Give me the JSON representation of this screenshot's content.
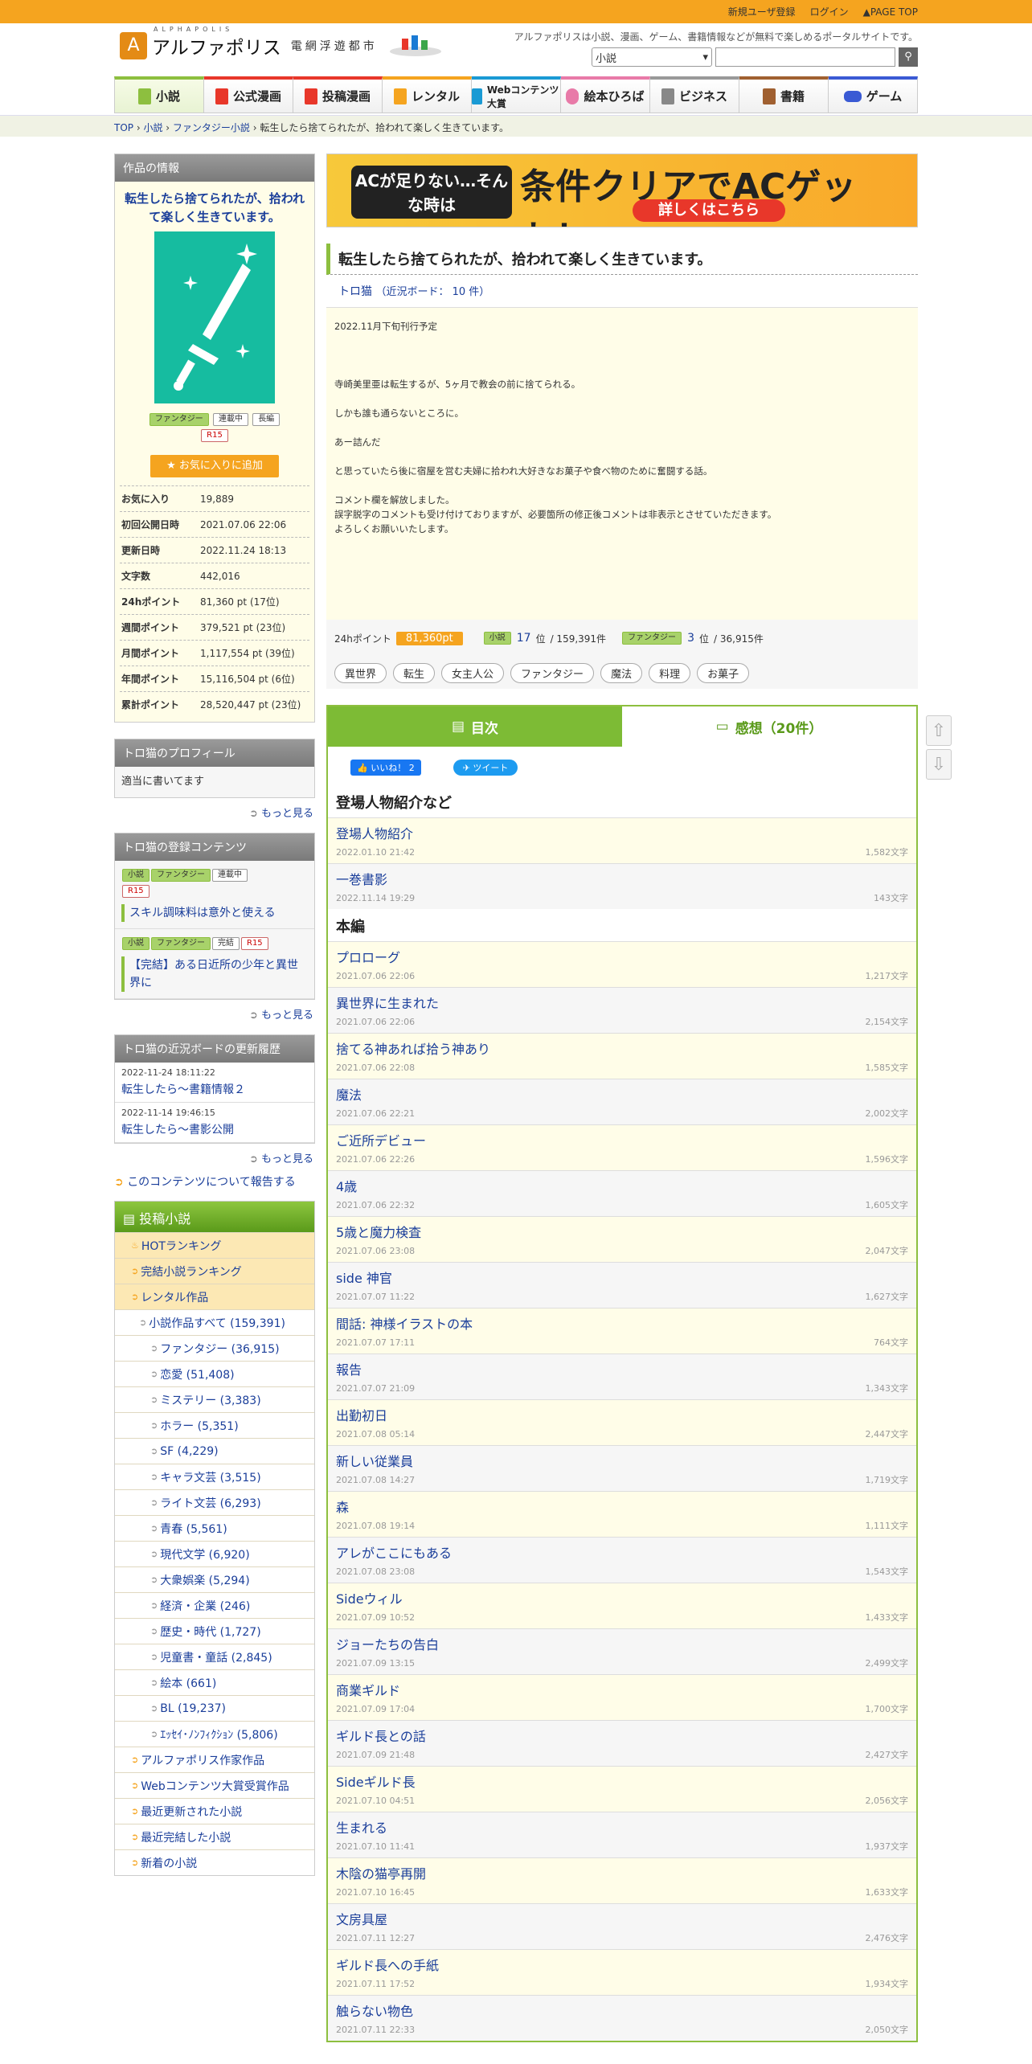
{
  "topbar": {
    "register": "新規ユーザ登録",
    "login": "ログイン",
    "pagetop": "PAGE TOP"
  },
  "logo": {
    "name": "アルファポリス",
    "sub": "電網浮遊都市",
    "ruby": "ALPHAPOLIS"
  },
  "tagline": "アルファポリスは小説、漫画、ゲーム、書籍情報などが無料で楽しめるポータルサイトです。",
  "search": {
    "category": "小説"
  },
  "gnav": [
    "小説",
    "公式漫画",
    "投稿漫画",
    "レンタル",
    "Webコンテンツ大賞",
    "絵本ひろば",
    "ビジネス",
    "書籍",
    "ゲーム"
  ],
  "breadcrumb": {
    "top": "TOP",
    "novel": "小説",
    "fantasy": "ファンタジー小説",
    "current": "転生したら捨てられたが、拾われて楽しく生きています。"
  },
  "workinfo": {
    "header": "作品の情報",
    "title": "転生したら捨てられたが、拾われて楽しく生きています。",
    "tags": [
      "ファンタジー",
      "連載中",
      "長編",
      "R15"
    ],
    "fav_button": "お気に入りに追加",
    "stats": [
      {
        "k": "お気に入り",
        "v": "19,889"
      },
      {
        "k": "初回公開日時",
        "v": "2021.07.06 22:06"
      },
      {
        "k": "更新日時",
        "v": "2022.11.24 18:13"
      },
      {
        "k": "文字数",
        "v": "442,016"
      },
      {
        "k": "24hポイント",
        "v": "81,360 pt (17位)"
      },
      {
        "k": "週間ポイント",
        "v": "379,521 pt (23位)"
      },
      {
        "k": "月間ポイント",
        "v": "1,117,554 pt (39位)"
      },
      {
        "k": "年間ポイント",
        "v": "15,116,504 pt (6位)"
      },
      {
        "k": "累計ポイント",
        "v": "28,520,447 pt (23位)"
      }
    ]
  },
  "profile": {
    "header": "トロ猫のプロフィール",
    "body": "適当に書いてます",
    "more": "もっと見る"
  },
  "registered": {
    "header": "トロ猫の登録コンテンツ",
    "items": [
      {
        "tags": [
          "小説",
          "ファンタジー",
          "連載中",
          "R15"
        ],
        "title": "スキル調味料は意外と使える"
      },
      {
        "tags": [
          "小説",
          "ファンタジー",
          "完結",
          "R15"
        ],
        "title": "【完結】ある日近所の少年と異世界に"
      }
    ],
    "more": "もっと見る"
  },
  "board": {
    "header": "トロ猫の近況ボードの更新履歴",
    "items": [
      {
        "date": "2022-11-24 18:11:22",
        "title": "転生したら～書籍情報２"
      },
      {
        "date": "2022-11-14 19:46:15",
        "title": "転生したら～書影公開"
      }
    ],
    "more": "もっと見る"
  },
  "report": "このコンテンツについて報告する",
  "catmenu": {
    "header": "投稿小説",
    "items": [
      {
        "label": "HOTランキング",
        "lv": "o"
      },
      {
        "label": "完結小説ランキング",
        "lv": "o"
      },
      {
        "label": "レンタル作品",
        "lv": "o"
      },
      {
        "label": "小説作品すべて (159,391)",
        "lv": "l1"
      },
      {
        "label": "ファンタジー (36,915)",
        "lv": "l2"
      },
      {
        "label": "恋愛 (51,408)",
        "lv": "l2"
      },
      {
        "label": "ミステリー (3,383)",
        "lv": "l2"
      },
      {
        "label": "ホラー (5,351)",
        "lv": "l2"
      },
      {
        "label": "SF (4,229)",
        "lv": "l2"
      },
      {
        "label": "キャラ文芸 (3,515)",
        "lv": "l2"
      },
      {
        "label": "ライト文芸 (6,293)",
        "lv": "l2"
      },
      {
        "label": "青春 (5,561)",
        "lv": "l2"
      },
      {
        "label": "現代文学 (6,920)",
        "lv": "l2"
      },
      {
        "label": "大衆娯楽 (5,294)",
        "lv": "l2"
      },
      {
        "label": "経済・企業 (246)",
        "lv": "l2"
      },
      {
        "label": "歴史・時代 (1,727)",
        "lv": "l2"
      },
      {
        "label": "児童書・童話 (2,845)",
        "lv": "l2"
      },
      {
        "label": "絵本 (661)",
        "lv": "l2"
      },
      {
        "label": "BL (19,237)",
        "lv": "l2"
      },
      {
        "label": "ｴｯｾｲ･ﾉﾝﾌｨｸｼｮﾝ (5,806)",
        "lv": "l2"
      },
      {
        "label": "アルファポリス作家作品",
        "lv": "w"
      },
      {
        "label": "Webコンテンツ大賞受賞作品",
        "lv": "w"
      },
      {
        "label": "最近更新された小説",
        "lv": "w"
      },
      {
        "label": "最近完結した小説",
        "lv": "w"
      },
      {
        "label": "新着の小説",
        "lv": "w"
      }
    ]
  },
  "banner": {
    "left": "ACが足りない…そんな時は",
    "right": "条件クリアでACゲット！",
    "button": "詳しくはこちら"
  },
  "work": {
    "title": "転生したら捨てられたが、拾われて楽しく生きています。",
    "author": "トロ猫",
    "board": "（近況ボード： 10 件）",
    "desc": [
      "2022.11月下旬刊行予定",
      "",
      "寺崎美里亜は転生するが、5ヶ月で教会の前に捨てられる。",
      "しかも誰も通らないところに。",
      "あー詰んだ",
      "と思っていたら後に宿屋を営む夫婦に拾われ大好きなお菓子や食べ物のために奮闘する話。",
      "コメント欄を解放しました。\n誤字脱字のコメントも受け付けておりますが、必要箇所の修正後コメントは非表示とさせていただきます。\nよろしくお願いいたします。"
    ]
  },
  "points": {
    "label": "24hポイント",
    "value": "81,360pt",
    "cat1": "小説",
    "rank1": "17",
    "total1": "/ 159,391件",
    "cat2": "ファンタジー",
    "rank2": "3",
    "total2": "/ 36,915件",
    "unit": "位"
  },
  "keywords": [
    "異世界",
    "転生",
    "女主人公",
    "ファンタジー",
    "魔法",
    "料理",
    "お菓子"
  ],
  "tabs": {
    "toc": "目次",
    "comments": "感想（20件）"
  },
  "social": {
    "fb": "いいね！ 2",
    "tw": "ツイート"
  },
  "toc": {
    "sections": [
      {
        "title": "登場人物紹介など",
        "eps": [
          {
            "t": "登場人物紹介",
            "d": "2022.01.10 21:42",
            "c": "1,582文字"
          },
          {
            "t": "一巻書影",
            "d": "2022.11.14 19:29",
            "c": "143文字"
          }
        ]
      },
      {
        "title": "本編",
        "eps": [
          {
            "t": "プロローグ",
            "d": "2021.07.06 22:06",
            "c": "1,217文字"
          },
          {
            "t": "異世界に生まれた",
            "d": "2021.07.06 22:06",
            "c": "2,154文字"
          },
          {
            "t": "捨てる神あれば拾う神あり",
            "d": "2021.07.06 22:08",
            "c": "1,585文字"
          },
          {
            "t": "魔法",
            "d": "2021.07.06 22:21",
            "c": "2,002文字"
          },
          {
            "t": "ご近所デビュー",
            "d": "2021.07.06 22:26",
            "c": "1,596文字"
          },
          {
            "t": "4歳",
            "d": "2021.07.06 22:32",
            "c": "1,605文字"
          },
          {
            "t": "5歳と魔力検査",
            "d": "2021.07.06 23:08",
            "c": "2,047文字"
          },
          {
            "t": "side 神官",
            "d": "2021.07.07 11:22",
            "c": "1,627文字"
          },
          {
            "t": "間話: 神様イラストの本",
            "d": "2021.07.07 17:11",
            "c": "764文字"
          },
          {
            "t": "報告",
            "d": "2021.07.07 21:09",
            "c": "1,343文字"
          },
          {
            "t": "出勤初日",
            "d": "2021.07.08 05:14",
            "c": "2,447文字"
          },
          {
            "t": "新しい従業員",
            "d": "2021.07.08 14:27",
            "c": "1,719文字"
          },
          {
            "t": "森",
            "d": "2021.07.08 19:14",
            "c": "1,111文字"
          },
          {
            "t": "アレがここにもある",
            "d": "2021.07.08 23:08",
            "c": "1,543文字"
          },
          {
            "t": "Sideウィル",
            "d": "2021.07.09 10:52",
            "c": "1,433文字"
          },
          {
            "t": "ジョーたちの告白",
            "d": "2021.07.09 13:15",
            "c": "2,499文字"
          },
          {
            "t": "商業ギルド",
            "d": "2021.07.09 17:04",
            "c": "1,700文字"
          },
          {
            "t": "ギルド長との話",
            "d": "2021.07.09 21:48",
            "c": "2,427文字"
          },
          {
            "t": "Sideギルド長",
            "d": "2021.07.10 04:51",
            "c": "2,056文字"
          },
          {
            "t": "生まれる",
            "d": "2021.07.10 11:41",
            "c": "1,937文字"
          },
          {
            "t": "木陰の猫亭再開",
            "d": "2021.07.10 16:45",
            "c": "1,633文字"
          },
          {
            "t": "文房具屋",
            "d": "2021.07.11 12:27",
            "c": "2,476文字"
          },
          {
            "t": "ギルド長への手紙",
            "d": "2021.07.11 17:52",
            "c": "1,934文字"
          },
          {
            "t": "触らない物色",
            "d": "2021.07.11 22:33",
            "c": "2,050文字"
          }
        ]
      }
    ]
  }
}
